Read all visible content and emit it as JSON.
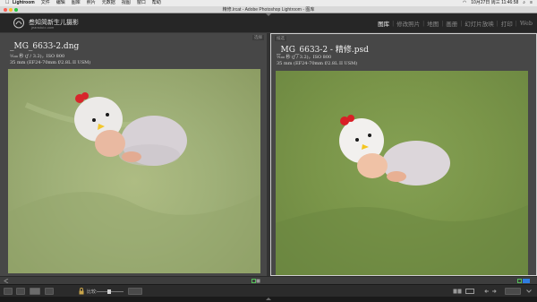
{
  "menubar": {
    "app_name": "Lightroom",
    "items": [
      "文件",
      "编辑",
      "图库",
      "照片",
      "元数据",
      "视图",
      "窗口",
      "帮助"
    ],
    "date_time": "10月27日 周三  11:46:58"
  },
  "window": {
    "title": "精修.lrcat - Adobe Photoshop Lightroom - 图库"
  },
  "identity": {
    "brand": "叁知简新生儿摄影",
    "url": "jeanstuio.com"
  },
  "modules": [
    {
      "label": "图库",
      "active": true
    },
    {
      "label": "修改照片",
      "active": false
    },
    {
      "label": "地图",
      "active": false
    },
    {
      "label": "画册",
      "active": false
    },
    {
      "label": "幻灯片放映",
      "active": false
    },
    {
      "label": "打印",
      "active": false
    },
    {
      "label": "Web",
      "active": false
    }
  ],
  "compare": {
    "left": {
      "tag": "选择",
      "filename": "_MG_6633-2.dng",
      "exposure": "¹⁄₁₀₀ 秒 (ƒ / 3.2)，ISO 800",
      "lens": "35 mm (EF24-70mm f/2.8L II USM)"
    },
    "right": {
      "tag": "候选",
      "filename": "_MG_6633-2 - 精修.psd",
      "exposure": "¹⁄₁₀₀ 秒 (ƒ / 3.2)，ISO 800",
      "lens": "35 mm (EF24-70mm f/2.8L II USM)"
    }
  },
  "toolbar": {
    "compare_label": "比较:",
    "zoom_level": 0.45
  },
  "colors": {
    "accent_selected_border": "#cfcfcf",
    "left_backdrop": "#a6b57d",
    "right_backdrop": "#7d9a4c"
  }
}
